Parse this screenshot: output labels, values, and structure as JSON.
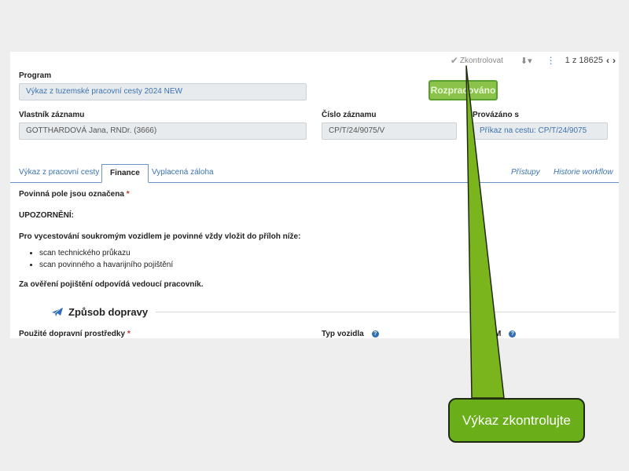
{
  "toolbar": {
    "check_label": "Zkontrolovat",
    "pager": "1 z 18625"
  },
  "form": {
    "program_label": "Program",
    "program_value": "Výkaz z tuzemské pracovní cesty 2024 NEW",
    "status_label": "Rozpracováno",
    "owner_label": "Vlastník záznamu",
    "owner_value": "GOTTHARDOVÁ Jana, RNDr. (3666)",
    "record_label": "Číslo záznamu",
    "record_value": "CP/T/24/9075/V",
    "linked_label": "Provázáno s",
    "linked_value": "Příkaz na cestu: CP/T/24/9075"
  },
  "tabs": {
    "items": [
      "Výkaz z pracovní cesty",
      "Finance",
      "Vyplacená záloha"
    ],
    "active": "Finance",
    "right_links": [
      "Přístupy",
      "Historie workflow"
    ]
  },
  "content": {
    "required_note": "Povinná pole jsou označena",
    "required_mark": "*",
    "warning": "UPOZORNĚNÍ:",
    "instruction": "Pro vycestování soukromým vozidlem je povinné vždy vložit do příloh níže:",
    "bullets": [
      "scan technického průkazu",
      "scan povinného a havarijního pojištění"
    ],
    "responsibility": "Za ověření pojištění odpovídá vedoucí pracovník."
  },
  "section": {
    "title": "Způsob dopravy",
    "field1_label": "Použité dopravní prostředky",
    "field2_label": "Typ vozidla",
    "field3_label": "M"
  },
  "callout": {
    "text": "Výkaz zkontrolujte"
  },
  "colors": {
    "accent_blue": "#3a73b0",
    "status_green": "#8bc34a",
    "callout_green": "#6aaf1a",
    "arrow_green": "#7ab51d"
  }
}
